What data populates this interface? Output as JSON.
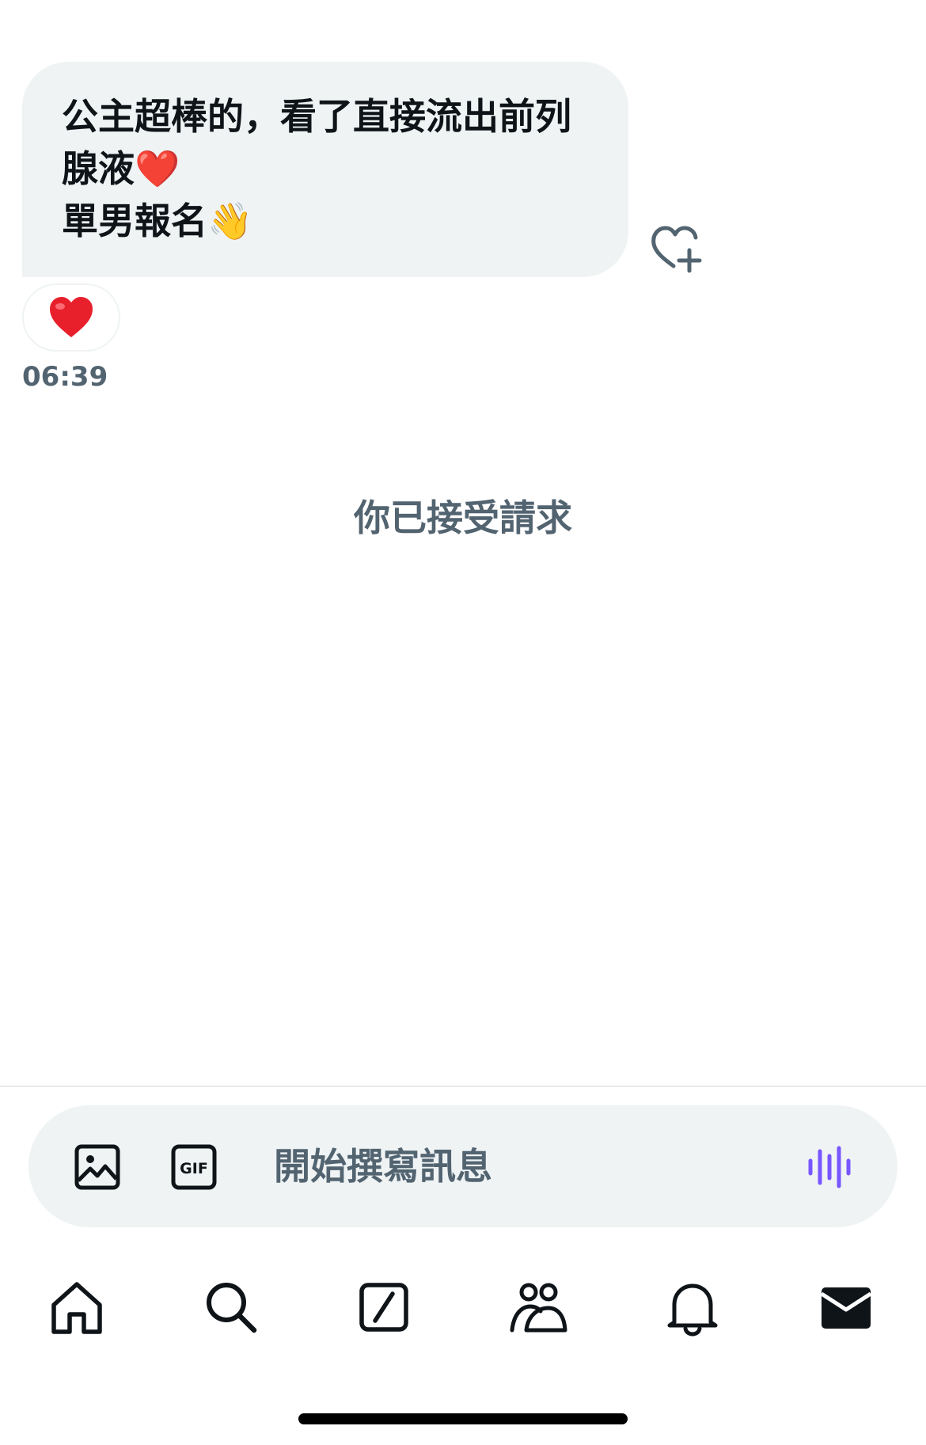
{
  "message": {
    "line1": "公主超棒的，看了直接流出前列",
    "line2_text": "腺液",
    "line2_emoji": "❤️",
    "line3_text": "單男報名",
    "line3_emoji": "👋",
    "reaction_emoji": "❤️",
    "timestamp": "06:39"
  },
  "system_message": "你已接受請求",
  "composer": {
    "placeholder": "開始撰寫訊息",
    "value": ""
  },
  "icons": {
    "add_reaction": "heart-plus-icon",
    "image": "image-icon",
    "gif": "gif-icon",
    "voice": "voice-wave-icon",
    "nav": [
      "home-icon",
      "search-icon",
      "grok-icon",
      "communities-icon",
      "notifications-icon",
      "messages-icon"
    ]
  },
  "colors": {
    "bubble_bg": "#eff3f4",
    "muted_text": "#536471",
    "voice_accent": "#7856ff",
    "heart": "#e8202b"
  }
}
